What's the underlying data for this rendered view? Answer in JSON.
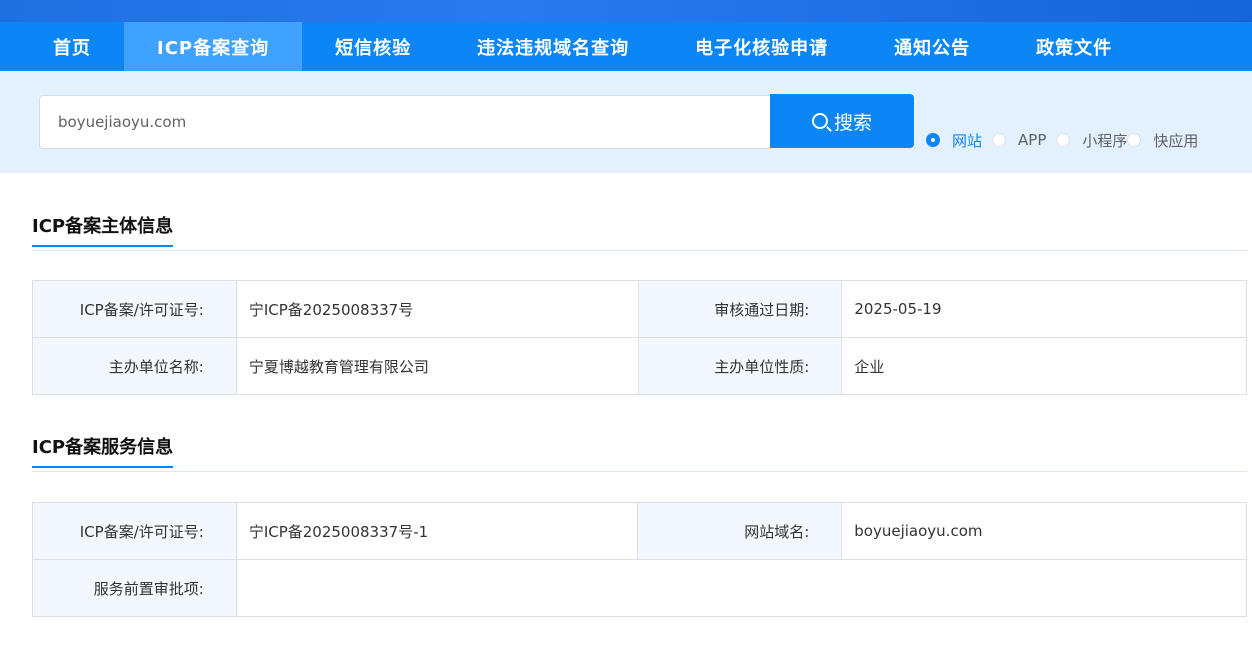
{
  "nav": {
    "items": [
      {
        "label": "首页"
      },
      {
        "label": "ICP备案查询"
      },
      {
        "label": "短信核验"
      },
      {
        "label": "违法违规域名查询"
      },
      {
        "label": "电子化核验申请"
      },
      {
        "label": "通知公告"
      },
      {
        "label": "政策文件"
      }
    ]
  },
  "search": {
    "value": "boyuejiaoyu.com",
    "button_label": "搜索",
    "options": [
      {
        "label": "网站",
        "checked": true
      },
      {
        "label": "APP",
        "checked": false
      },
      {
        "label": "小程序",
        "checked": false
      },
      {
        "label": "快应用",
        "checked": false
      }
    ]
  },
  "subject_section": {
    "title": "ICP备案主体信息",
    "rows": [
      {
        "label1": "ICP备案/许可证号:",
        "value1": "宁ICP备2025008337号",
        "label2": "审核通过日期:",
        "value2": "2025-05-19"
      },
      {
        "label1": "主办单位名称:",
        "value1": "宁夏博越教育管理有限公司",
        "label2": "主办单位性质:",
        "value2": "企业"
      }
    ]
  },
  "service_section": {
    "title": "ICP备案服务信息",
    "row1": {
      "label1": "ICP备案/许可证号:",
      "value1": "宁ICP备2025008337号-1",
      "label2": "网站域名:",
      "value2": "boyuejiaoyu.com"
    },
    "row2": {
      "label1": "服务前置审批项:",
      "value1": ""
    }
  },
  "colors": {
    "accent": "#0d86f5",
    "nav_active": "#3fa2ff",
    "search_bg": "#e3f0fd",
    "label_bg": "#f2f8fd"
  }
}
